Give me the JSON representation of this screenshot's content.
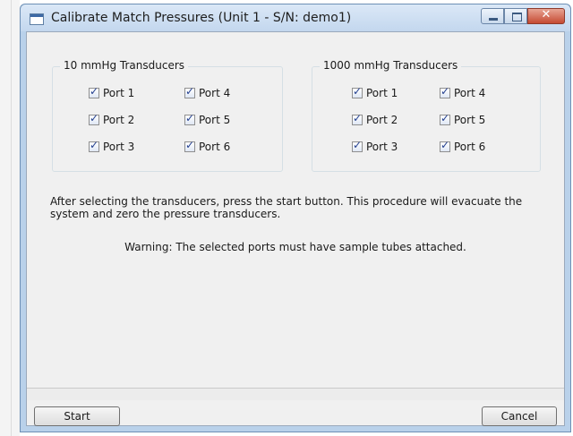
{
  "window": {
    "title": "Calibrate Match Pressures (Unit 1 - S/N: demo1)"
  },
  "groups": {
    "low": {
      "title": "10 mmHg Transducers",
      "ports": [
        "Port 1",
        "Port 2",
        "Port 3",
        "Port 4",
        "Port 5",
        "Port 6"
      ],
      "checked": [
        true,
        true,
        true,
        true,
        true,
        true
      ]
    },
    "high": {
      "title": "1000 mmHg Transducers",
      "ports": [
        "Port 1",
        "Port 2",
        "Port 3",
        "Port 4",
        "Port 5",
        "Port 6"
      ],
      "checked": [
        true,
        true,
        true,
        true,
        true,
        true
      ]
    }
  },
  "info_text": "After selecting the transducers, press the start button. This procedure will evacuate the system and zero the pressure transducers.",
  "warning_text": "Warning: The selected ports must have sample tubes attached.",
  "buttons": {
    "start": "Start",
    "cancel": "Cancel"
  }
}
